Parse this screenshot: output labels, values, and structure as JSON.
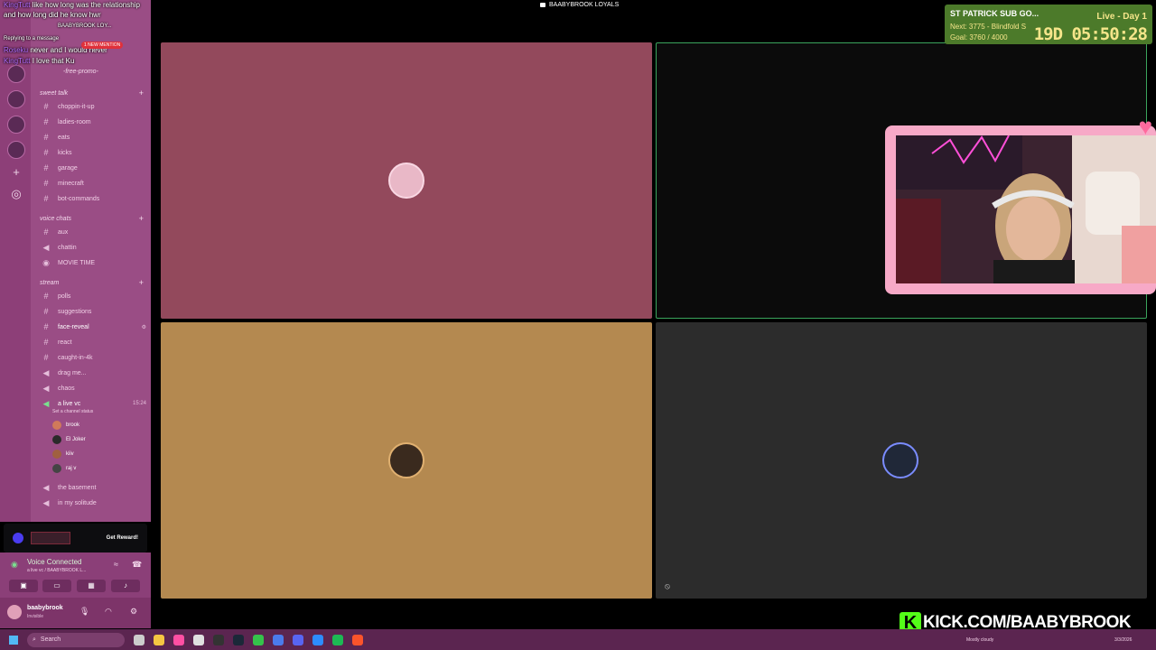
{
  "chat": {
    "lines": [
      {
        "user": "KingTutt",
        "text": "like how long was the relationship"
      },
      {
        "user": "",
        "text": "and how long did he know hwr"
      },
      {
        "user": "",
        "text": "BAABYBROOK LOY..."
      },
      {
        "user": "",
        "text": "Replying to a message"
      },
      {
        "user": "Roseku",
        "text": "never and I would never"
      },
      {
        "user": "KingTutt",
        "text": "I love that Ku"
      }
    ],
    "mention": "1 NEW MENTION"
  },
  "sidebar": {
    "free_promo": "-free-promo-",
    "categories": {
      "sweet_talk": "sweet talk",
      "voice_chats": "voice chats",
      "stream": "stream"
    },
    "channels_sweet": [
      "choppin-it-up",
      "ladies-room",
      "eats",
      "kicks",
      "garage",
      "minecraft",
      "bot-commands"
    ],
    "channels_voice": [
      "aux",
      "chattin",
      "MOVIE TIME"
    ],
    "channels_stream": [
      "polls",
      "suggestions",
      "face-reveal",
      "react",
      "caught-in-4k",
      "drag me...",
      "chaos",
      "a live vc",
      "the basement",
      "in my solitude"
    ],
    "live_vc_time": "15:24",
    "live_vc_status": "Set a channel status",
    "members": [
      "brook",
      "El Joker",
      "kiiv",
      "raj v"
    ]
  },
  "nitro": {
    "reward": "Get Reward!"
  },
  "voice": {
    "title": "Voice Connected",
    "subtitle": "a live vc / BAABYBROOK L..."
  },
  "user": {
    "name": "baabybrook",
    "status": "Invisible"
  },
  "stage": {
    "title": "BAABYBROOK LOYALS"
  },
  "subathon": {
    "title": "ST PATRICK SUB GO...",
    "next": "Next: 3775 - Blindfold S",
    "goal": "Goal: 3760 / 4000",
    "day": "Live - Day 1",
    "timer": "19D 05:50:28"
  },
  "kick": {
    "letter": "K",
    "url": "KICK.COM/BAABYBROOK"
  },
  "taskbar": {
    "search": "Search",
    "weather": "Mostly cloudy",
    "date": "3/3/2026"
  },
  "colors": {
    "sidebar": "#9a4d85",
    "tile_pink": "#93495c",
    "tile_dark": "#0b0b0b",
    "tile_tan": "#b48950",
    "tile_gray": "#2c2c2c",
    "speaking": "#3ba55d"
  }
}
